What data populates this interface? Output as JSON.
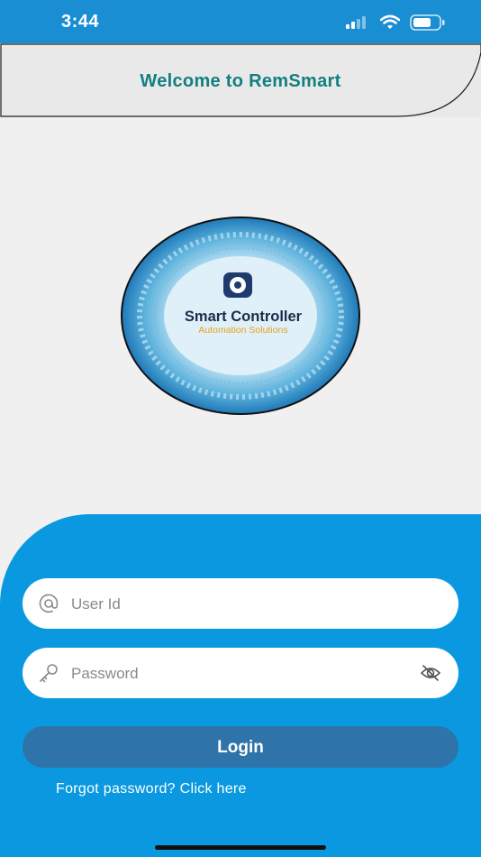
{
  "status_bar": {
    "time": "3:44",
    "icons": [
      "signal-icon",
      "wifi-icon",
      "battery-icon"
    ]
  },
  "header": {
    "title": "Welcome to RemSmart"
  },
  "logo": {
    "title": "Smart Controller",
    "subtitle": "Automation Solutions"
  },
  "login_form": {
    "user_id": {
      "placeholder": "User Id",
      "value": "",
      "icon": "at-icon"
    },
    "password": {
      "placeholder": "Password",
      "value": "",
      "icon": "key-icon",
      "toggle_icon": "eye-slash-icon"
    },
    "login_label": "Login",
    "forgot_text": "Forgot password? Click here"
  },
  "colors": {
    "status_bar": "#1a8ed3",
    "header_title": "#137f80",
    "panel": "#0a99e0",
    "login_button": "#2e73aa",
    "logo_subtitle": "#e8a020"
  }
}
